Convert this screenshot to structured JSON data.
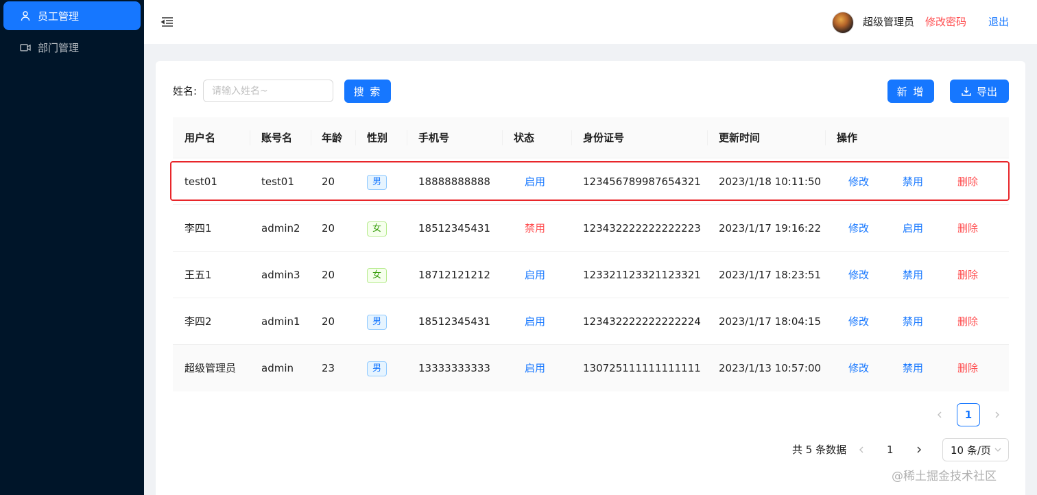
{
  "sidebar": {
    "items": [
      {
        "label": "员工管理",
        "icon": "user-icon",
        "active": true
      },
      {
        "label": "部门管理",
        "icon": "video-camera-icon",
        "active": false
      }
    ]
  },
  "header": {
    "user_name": "超级管理员",
    "change_password": "修改密码",
    "logout": "退出"
  },
  "search": {
    "label": "姓名:",
    "placeholder": "请输入姓名~",
    "button": "搜 索"
  },
  "toolbar": {
    "add_label": "新 增",
    "export_label": "导出"
  },
  "table": {
    "columns": [
      "用户名",
      "账号名",
      "年龄",
      "性别",
      "手机号",
      "状态",
      "身份证号",
      "更新时间",
      "操作"
    ],
    "rows": [
      {
        "username": "test01",
        "account": "test01",
        "age": "20",
        "gender": "男",
        "phone": "18888888888",
        "status": "启用",
        "id_card": "123456789987654321",
        "updated": "2023/1/18 10:11:50",
        "edit": "修改",
        "toggle": "禁用",
        "delete": "删除"
      },
      {
        "username": "李四1",
        "account": "admin2",
        "age": "20",
        "gender": "女",
        "phone": "18512345431",
        "status": "禁用",
        "id_card": "123432222222222223",
        "updated": "2023/1/17 19:16:22",
        "edit": "修改",
        "toggle": "启用",
        "delete": "删除"
      },
      {
        "username": "王五1",
        "account": "admin3",
        "age": "20",
        "gender": "女",
        "phone": "18712121212",
        "status": "启用",
        "id_card": "123321123321123321",
        "updated": "2023/1/17 18:23:51",
        "edit": "修改",
        "toggle": "禁用",
        "delete": "删除"
      },
      {
        "username": "李四2",
        "account": "admin1",
        "age": "20",
        "gender": "男",
        "phone": "18512345431",
        "status": "启用",
        "id_card": "123432222222222224",
        "updated": "2023/1/17 18:04:15",
        "edit": "修改",
        "toggle": "禁用",
        "delete": "删除"
      },
      {
        "username": "超级管理员",
        "account": "admin",
        "age": "23",
        "gender": "男",
        "phone": "13333333333",
        "status": "启用",
        "id_card": "130725111111111111",
        "updated": "2023/1/13 10:57:00",
        "edit": "修改",
        "toggle": "禁用",
        "delete": "删除"
      }
    ]
  },
  "pagination_top": {
    "current": "1"
  },
  "pagination_bottom": {
    "total_text": "共 5 条数据",
    "current": "1",
    "page_size": "10 条/页"
  },
  "watermark": "@稀土掘金技术社区",
  "colors": {
    "primary": "#1677ff",
    "danger": "#ff4d4f",
    "sidebar_bg": "#001529",
    "highlight_border": "#e8262a"
  }
}
